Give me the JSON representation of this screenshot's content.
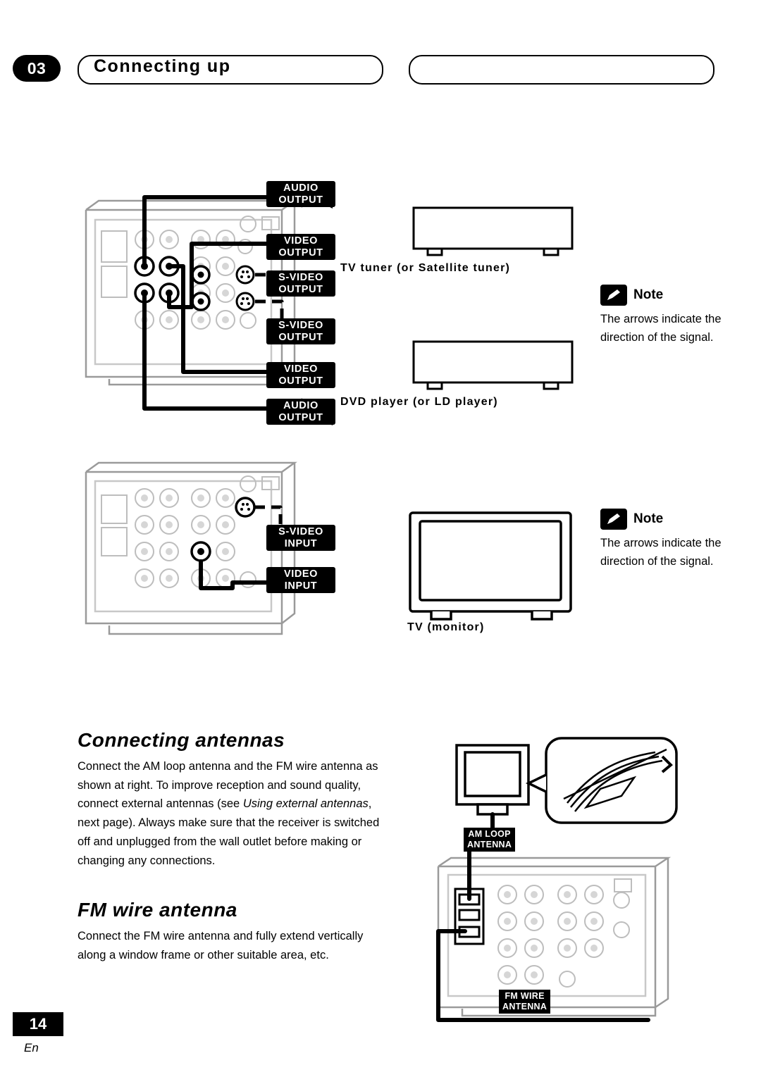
{
  "header": {
    "chapter_number": "03",
    "title": "Connecting up"
  },
  "diagram1": {
    "connectors": [
      {
        "line1": "AUDIO",
        "line2": "OUTPUT"
      },
      {
        "line1": "VIDEO",
        "line2": "OUTPUT"
      },
      {
        "line1": "S-VIDEO",
        "line2": "OUTPUT"
      },
      {
        "line1": "S-VIDEO",
        "line2": "OUTPUT"
      },
      {
        "line1": "VIDEO",
        "line2": "OUTPUT"
      },
      {
        "line1": "AUDIO",
        "line2": "OUTPUT"
      }
    ],
    "device_top": "TV tuner (or Satellite tuner)",
    "device_bottom": "DVD player (or LD player)",
    "note": {
      "title": "Note",
      "body": "The arrows indicate the direction of the signal."
    }
  },
  "diagram2": {
    "connectors": [
      {
        "line1": "S-VIDEO",
        "line2": "INPUT"
      },
      {
        "line1": "VIDEO",
        "line2": "INPUT"
      }
    ],
    "device": "TV (monitor)",
    "note": {
      "title": "Note",
      "body": "The arrows indicate the direction of the signal."
    }
  },
  "sections": [
    {
      "heading": "Connecting antennas",
      "paragraph_part1": "Connect the AM loop antenna and the FM wire antenna as shown at right. To improve reception and sound quality, connect external antennas (see ",
      "paragraph_italic": "Using external antennas",
      "paragraph_part2": ", next page). Always make sure that the receiver is switched off and unplugged from the wall outlet before making or changing any connections."
    },
    {
      "heading": "FM wire antenna",
      "paragraph": "Connect the FM wire antenna and fully extend vertically along a window frame or other suitable area, etc."
    }
  ],
  "antenna_diagram": {
    "am_label_line1": "AM LOOP",
    "am_label_line2": "ANTENNA",
    "fm_label_line1": "FM WIRE",
    "fm_label_line2": "ANTENNA"
  },
  "footer": {
    "page_number": "14",
    "language": "En"
  }
}
